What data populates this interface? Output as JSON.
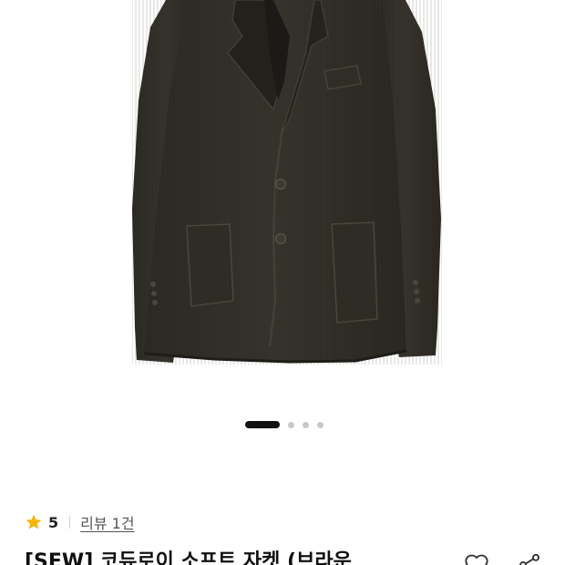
{
  "product": {
    "image_alt": "corduroy jacket",
    "title": "[SEW] 코듀로이 소프트 자켓 (브라운",
    "rating": "5",
    "review_label": "리뷰 1건"
  },
  "carousel": {
    "total": 4,
    "active_index": 0
  },
  "icons": {
    "rating": "star-icon",
    "wishlist": "heart-icon",
    "share": "share-icon"
  },
  "colors": {
    "star": "#F5B400",
    "active_dot": "#111111",
    "inactive_dot": "#C8C8C8",
    "jacket": "#2C2A24"
  }
}
